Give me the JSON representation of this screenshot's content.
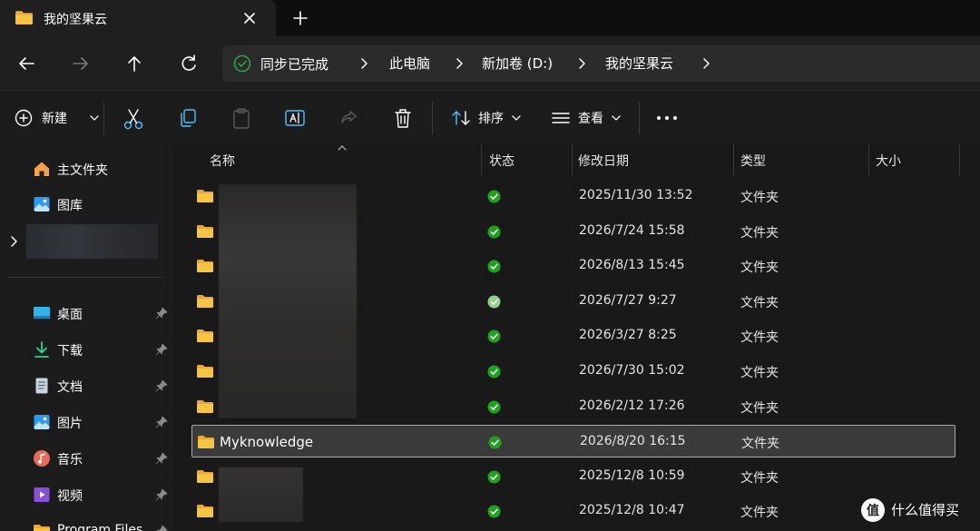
{
  "window": {
    "tab_title": "我的坚果云"
  },
  "address": {
    "status": "同步已完成",
    "crumbs": [
      "此电脑",
      "新加卷 (D:)",
      "我的坚果云"
    ]
  },
  "toolbar": {
    "new_label": "新建",
    "sort_label": "排序",
    "view_label": "查看"
  },
  "sidebar": {
    "home": "主文件夹",
    "gallery": "图库",
    "pinned": [
      {
        "label": "桌面",
        "icon": "desktop-icon"
      },
      {
        "label": "下载",
        "icon": "download-icon"
      },
      {
        "label": "文档",
        "icon": "document-icon"
      },
      {
        "label": "图片",
        "icon": "pictures-icon"
      },
      {
        "label": "音乐",
        "icon": "music-icon"
      },
      {
        "label": "视频",
        "icon": "video-icon"
      },
      {
        "label": "Program Files",
        "icon": "folder-icon"
      }
    ]
  },
  "columns": {
    "name": "名称",
    "status": "状态",
    "modified": "修改日期",
    "type": "类型",
    "size": "大小"
  },
  "files": [
    {
      "name": "",
      "date": "2025/11/30 13:52",
      "type": "文件夹",
      "status": "synced"
    },
    {
      "name": "",
      "date": "2026/7/24 15:58",
      "type": "文件夹",
      "status": "synced"
    },
    {
      "name": "",
      "date": "2026/8/13 15:45",
      "type": "文件夹",
      "status": "synced"
    },
    {
      "name": "",
      "date": "2026/7/27 9:27",
      "type": "文件夹",
      "status": "synced-light"
    },
    {
      "name": "",
      "date": "2026/3/27 8:25",
      "type": "文件夹",
      "status": "synced"
    },
    {
      "name": "",
      "date": "2026/7/30 15:02",
      "type": "文件夹",
      "status": "synced"
    },
    {
      "name": "",
      "date": "2026/2/12 17:26",
      "type": "文件夹",
      "status": "synced"
    },
    {
      "name": "Myknowledge",
      "date": "2026/8/20 16:15",
      "type": "文件夹",
      "status": "synced",
      "selected": true
    },
    {
      "name": "",
      "date": "2025/12/8 10:59",
      "type": "文件夹",
      "status": "synced"
    },
    {
      "name": "",
      "date": "2025/12/8 10:47",
      "type": "文件夹",
      "status": "synced"
    }
  ],
  "watermark": {
    "text": "什么值得买"
  },
  "colors": {
    "accent": "#4cc2ff",
    "synced": "#1fa31f",
    "folder": "#f6c443"
  }
}
